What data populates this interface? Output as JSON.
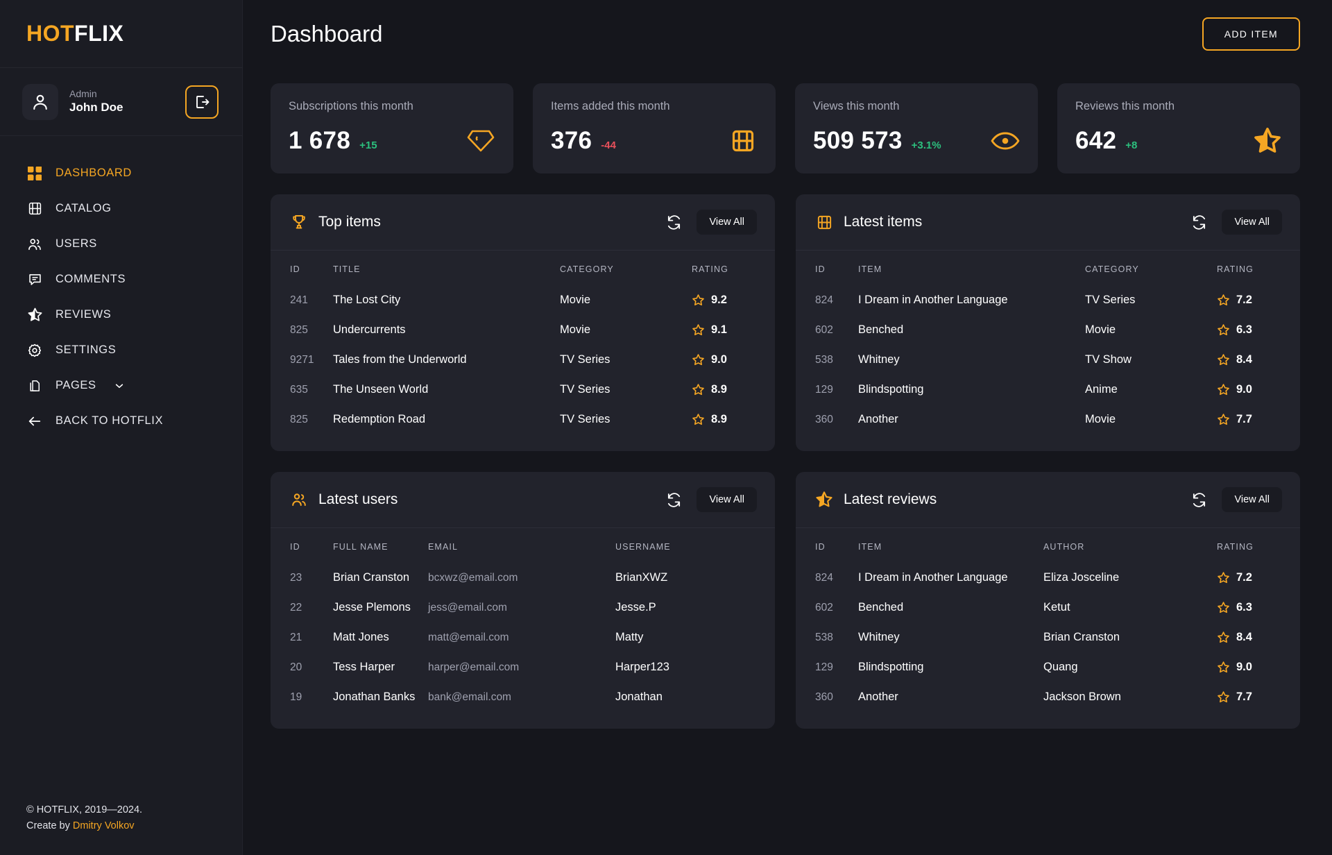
{
  "brand": {
    "part1": "HOT",
    "part2": "FLIX"
  },
  "user": {
    "role": "Admin",
    "name": "John Doe"
  },
  "sidebar": {
    "items": [
      {
        "label": "DASHBOARD",
        "icon": "grid-icon",
        "active": true
      },
      {
        "label": "CATALOG",
        "icon": "film-icon",
        "active": false
      },
      {
        "label": "USERS",
        "icon": "users-icon",
        "active": false
      },
      {
        "label": "COMMENTS",
        "icon": "comment-icon",
        "active": false
      },
      {
        "label": "REVIEWS",
        "icon": "star-half-icon",
        "active": false
      },
      {
        "label": "SETTINGS",
        "icon": "gear-icon",
        "active": false
      },
      {
        "label": "PAGES",
        "icon": "pages-icon",
        "active": false,
        "chevron": true
      },
      {
        "label": "BACK TO HOTFLIX",
        "icon": "arrow-left-icon",
        "active": false
      }
    ]
  },
  "footer": {
    "copyright": "© HOTFLIX, 2019—2024.",
    "create_by_prefix": "Create by",
    "author": "Dmitry Volkov"
  },
  "header": {
    "title": "Dashboard",
    "add_item_label": "ADD ITEM"
  },
  "stats": [
    {
      "label": "Subscriptions this month",
      "value": "1 678",
      "delta": "+15",
      "direction": "up",
      "icon": "diamond-icon"
    },
    {
      "label": "Items added this month",
      "value": "376",
      "delta": "-44",
      "direction": "down",
      "icon": "film-icon"
    },
    {
      "label": "Views this month",
      "value": "509 573",
      "delta": "+3.1%",
      "direction": "up",
      "icon": "eye-icon"
    },
    {
      "label": "Reviews this month",
      "value": "642",
      "delta": "+8",
      "direction": "up",
      "icon": "star-half-icon"
    }
  ],
  "panels": {
    "top_items": {
      "title": "Top items",
      "icon": "trophy-icon",
      "view_all": "View All",
      "refresh": "refresh-icon",
      "columns": [
        "ID",
        "TITLE",
        "CATEGORY",
        "RATING"
      ],
      "rows": [
        {
          "id": "241",
          "title": "The Lost City",
          "category": "Movie",
          "rating": "9.2"
        },
        {
          "id": "825",
          "title": "Undercurrents",
          "category": "Movie",
          "rating": "9.1"
        },
        {
          "id": "9271",
          "title": "Tales from the Underworld",
          "category": "TV Series",
          "rating": "9.0"
        },
        {
          "id": "635",
          "title": "The Unseen World",
          "category": "TV Series",
          "rating": "8.9"
        },
        {
          "id": "825",
          "title": "Redemption Road",
          "category": "TV Series",
          "rating": "8.9"
        }
      ]
    },
    "latest_items": {
      "title": "Latest items",
      "icon": "film-icon",
      "view_all": "View All",
      "refresh": "refresh-icon",
      "columns": [
        "ID",
        "ITEM",
        "CATEGORY",
        "RATING"
      ],
      "rows": [
        {
          "id": "824",
          "title": "I Dream in Another Language",
          "category": "TV Series",
          "rating": "7.2"
        },
        {
          "id": "602",
          "title": "Benched",
          "category": "Movie",
          "rating": "6.3"
        },
        {
          "id": "538",
          "title": "Whitney",
          "category": "TV Show",
          "rating": "8.4"
        },
        {
          "id": "129",
          "title": "Blindspotting",
          "category": "Anime",
          "rating": "9.0"
        },
        {
          "id": "360",
          "title": "Another",
          "category": "Movie",
          "rating": "7.7"
        }
      ]
    },
    "latest_users": {
      "title": "Latest users",
      "icon": "users-icon",
      "view_all": "View All",
      "refresh": "refresh-icon",
      "columns": [
        "ID",
        "FULL NAME",
        "EMAIL",
        "USERNAME"
      ],
      "rows": [
        {
          "id": "23",
          "full_name": "Brian Cranston",
          "email": "bcxwz@email.com",
          "username": "BrianXWZ"
        },
        {
          "id": "22",
          "full_name": "Jesse Plemons",
          "email": "jess@email.com",
          "username": "Jesse.P"
        },
        {
          "id": "21",
          "full_name": "Matt Jones",
          "email": "matt@email.com",
          "username": "Matty"
        },
        {
          "id": "20",
          "full_name": "Tess Harper",
          "email": "harper@email.com",
          "username": "Harper123"
        },
        {
          "id": "19",
          "full_name": "Jonathan Banks",
          "email": "bank@email.com",
          "username": "Jonathan"
        }
      ]
    },
    "latest_reviews": {
      "title": "Latest reviews",
      "icon": "star-icon",
      "view_all": "View All",
      "refresh": "refresh-icon",
      "columns": [
        "ID",
        "ITEM",
        "AUTHOR",
        "RATING"
      ],
      "rows": [
        {
          "id": "824",
          "item": "I Dream in Another Language",
          "author": "Eliza Josceline",
          "rating": "7.2"
        },
        {
          "id": "602",
          "item": "Benched",
          "author": "Ketut",
          "rating": "6.3"
        },
        {
          "id": "538",
          "item": "Whitney",
          "author": "Brian Cranston",
          "rating": "8.4"
        },
        {
          "id": "129",
          "item": "Blindspotting",
          "author": "Quang",
          "rating": "9.0"
        },
        {
          "id": "360",
          "item": "Another",
          "author": "Jackson Brown",
          "rating": "7.7"
        }
      ]
    }
  },
  "colors": {
    "accent": "#f5a623",
    "up": "#2cc07e",
    "down": "#e8505b",
    "panel_bg": "#22232c",
    "page_bg": "#15161c",
    "sidebar_bg": "#1b1c23"
  }
}
